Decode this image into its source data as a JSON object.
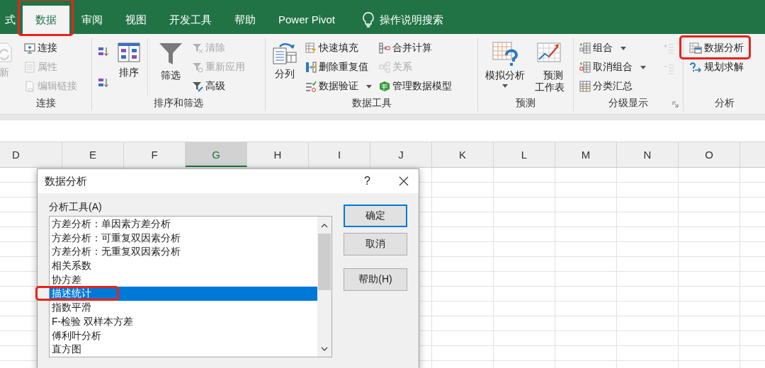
{
  "tabs": [
    {
      "label": "式",
      "selected": false
    },
    {
      "label": "数据",
      "selected": true,
      "highlighted": true
    },
    {
      "label": "审阅",
      "selected": false
    },
    {
      "label": "视图",
      "selected": false
    },
    {
      "label": "开发工具",
      "selected": false
    },
    {
      "label": "帮助",
      "selected": false
    },
    {
      "label": "Power Pivot",
      "selected": false
    }
  ],
  "tell_me": {
    "label": "操作说明搜索"
  },
  "ribbon": {
    "groups": [
      {
        "label": "连接",
        "columns": [
          {
            "kind": "large",
            "items": [
              {
                "label": "新",
                "disabled": true,
                "dropdown": false
              }
            ]
          },
          {
            "kind": "stack",
            "items": [
              {
                "label": "连接",
                "disabled": false,
                "dropdown": false
              },
              {
                "label": "属性",
                "disabled": true,
                "dropdown": false
              },
              {
                "label": "编辑链接",
                "disabled": true,
                "dropdown": false
              }
            ]
          }
        ]
      },
      {
        "label": "排序和筛选",
        "columns": [
          {
            "kind": "stack",
            "items": [
              {
                "disabled": false,
                "dropdown": false
              },
              {
                "disabled": false,
                "dropdown": false
              }
            ]
          },
          {
            "kind": "large",
            "items": [
              {
                "label": "排序",
                "disabled": false,
                "dropdown": false
              }
            ]
          },
          {
            "kind": "large",
            "items": [
              {
                "label": "筛选",
                "disabled": false,
                "dropdown": false
              }
            ]
          },
          {
            "kind": "stack",
            "items": [
              {
                "label": "清除",
                "disabled": true,
                "dropdown": false
              },
              {
                "label": "重新应用",
                "disabled": true,
                "dropdown": false
              },
              {
                "label": "高级",
                "disabled": false,
                "dropdown": false
              }
            ]
          }
        ]
      },
      {
        "label": "数据工具",
        "columns": [
          {
            "kind": "large",
            "items": [
              {
                "label": "分列",
                "disabled": false,
                "dropdown": false
              }
            ]
          },
          {
            "kind": "stack",
            "items": [
              {
                "label": "快速填充",
                "disabled": false,
                "dropdown": false
              },
              {
                "label": "删除重复值",
                "disabled": false,
                "dropdown": false
              },
              {
                "label": "数据验证",
                "disabled": false,
                "dropdown": true
              }
            ]
          },
          {
            "kind": "stack",
            "items": [
              {
                "label": "合并计算",
                "disabled": false,
                "dropdown": false
              },
              {
                "label": "关系",
                "disabled": true,
                "dropdown": false
              },
              {
                "label": "管理数据模型",
                "disabled": false,
                "dropdown": false
              }
            ]
          }
        ]
      },
      {
        "label": "预测",
        "columns": [
          {
            "kind": "large",
            "items": [
              {
                "label": "模拟分析",
                "disabled": false,
                "dropdown": true
              }
            ]
          },
          {
            "kind": "large",
            "items": [
              {
                "label": "预测工作表",
                "disabled": false,
                "dropdown": false
              }
            ]
          }
        ]
      },
      {
        "label": "分级显示",
        "launcher": true,
        "columns": [
          {
            "kind": "stack",
            "items": [
              {
                "label": "组合",
                "disabled": false,
                "dropdown": true
              },
              {
                "label": "取消组合",
                "disabled": false,
                "dropdown": true
              },
              {
                "label": "分类汇总",
                "disabled": false,
                "dropdown": false
              }
            ]
          },
          {
            "kind": "stack",
            "items": [
              {
                "disabled": true,
                "dropdown": false
              },
              {
                "disabled": true,
                "dropdown": false
              }
            ]
          }
        ]
      },
      {
        "label": "分析",
        "columns": [
          {
            "kind": "stack",
            "items": [
              {
                "label": "数据分析",
                "disabled": false,
                "dropdown": false,
                "highlighted": true
              },
              {
                "label": "规划求解",
                "disabled": false,
                "dropdown": false
              }
            ]
          }
        ]
      }
    ]
  },
  "columns": [
    {
      "label": "D",
      "selected": false
    },
    {
      "label": "E",
      "selected": false
    },
    {
      "label": "F",
      "selected": false
    },
    {
      "label": "G",
      "selected": true
    },
    {
      "label": "H",
      "selected": false
    },
    {
      "label": "I",
      "selected": false
    },
    {
      "label": "J",
      "selected": false
    },
    {
      "label": "K",
      "selected": false
    },
    {
      "label": "L",
      "selected": false
    },
    {
      "label": "M",
      "selected": false
    },
    {
      "label": "N",
      "selected": false
    },
    {
      "label": "O",
      "selected": false
    }
  ],
  "dialog": {
    "title": "数据分析",
    "help": "?",
    "list_label": "分析工具(A)",
    "items": [
      {
        "label": "方差分析：单因素方差分析",
        "selected": false
      },
      {
        "label": "方差分析：可重复双因素分析",
        "selected": false
      },
      {
        "label": "方差分析：无重复双因素分析",
        "selected": false
      },
      {
        "label": "相关系数",
        "selected": false
      },
      {
        "label": "协方差",
        "selected": false
      },
      {
        "label": "描述统计",
        "selected": true,
        "highlighted": true
      },
      {
        "label": "指数平滑",
        "selected": false
      },
      {
        "label": "F-检验 双样本方差",
        "selected": false
      },
      {
        "label": "傅利叶分析",
        "selected": false
      },
      {
        "label": "直方图",
        "selected": false
      }
    ],
    "buttons": [
      {
        "label": "确定",
        "default": true
      },
      {
        "label": "取消",
        "default": false
      },
      {
        "label": "帮助(H)",
        "default": false
      }
    ]
  }
}
